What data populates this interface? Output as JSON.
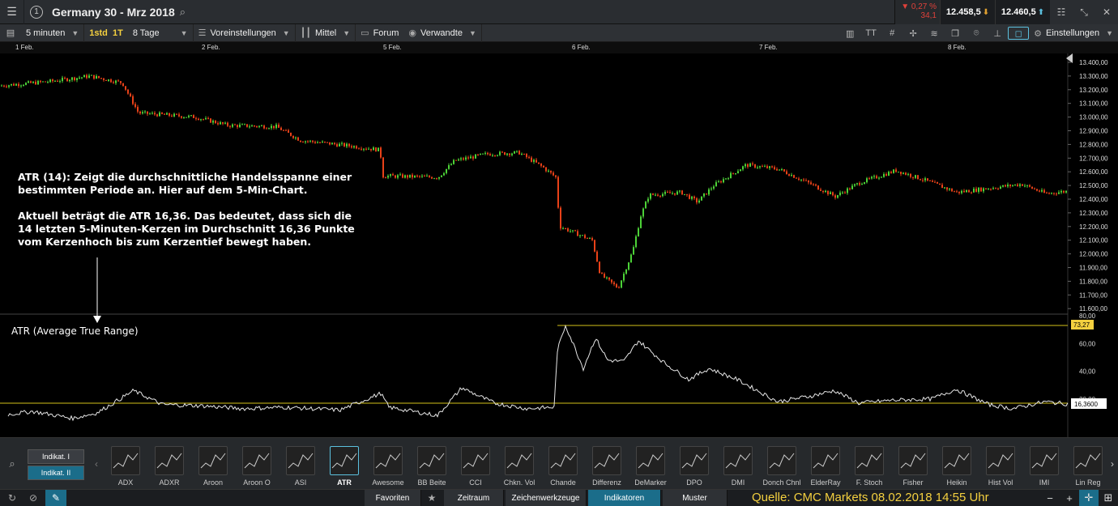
{
  "header": {
    "menu_icon": "hamburger-icon",
    "product_number": "1",
    "title": "Germany 30 - Mrz 2018",
    "change_pct": "▼ 0,27 %",
    "change_pts": "34,1",
    "bid": "12.458,5",
    "ask": "12.460,5",
    "bid_icon": "arrow-down-icon",
    "ask_icon": "arrow-up-icon"
  },
  "toolbar": {
    "interval": "5 minuten",
    "first_label": "1std",
    "second_label": "1T",
    "range": "8 Tage",
    "presets": "Voreinstellungen",
    "chart_type": "Mittel",
    "forum": "Forum",
    "related": "Verwandte",
    "settings": "Einstellungen",
    "text_icon_label": "TT"
  },
  "dates": [
    "1 Feb.",
    "2 Feb.",
    "5 Feb.",
    "6 Feb.",
    "7 Feb.",
    "8 Feb."
  ],
  "price_axis": [
    "13.400,00",
    "13.300,00",
    "13.200,00",
    "13.100,00",
    "13.000,00",
    "12.900,00",
    "12.800,00",
    "12.700,00",
    "12.600,00",
    "12.500,00",
    "12.400,00",
    "12.300,00",
    "12.200,00",
    "12.100,00",
    "12.000,00",
    "11.900,00",
    "11.800,00",
    "11.700,00",
    "11.600,00"
  ],
  "atr_axis": [
    "80,00",
    "60,00",
    "40,00",
    "20,00"
  ],
  "atr_max_label": "73,27",
  "atr_current_label": "16,3600",
  "annotation": {
    "p1": "ATR (14): Zeigt die durchschnittliche Handelsspanne einer bestimmten Periode an. Hier auf dem 5-Min-Chart.",
    "p2": "Aktuell beträgt die ATR 16,36. Das bedeutet, dass sich die 14 letzten 5-Minuten-Kerzen im Durchschnitt 16,36 Punkte vom Kerzenhoch bis zum Kerzentief bewegt haben."
  },
  "atr_title": "ATR (Average True Range)",
  "indicator_tabs": {
    "first": "Indikat. I",
    "second": "Indikat. II"
  },
  "indicators": [
    "ADX",
    "ADXR",
    "Aroon",
    "Aroon O",
    "ASI",
    "ATR",
    "Awesome",
    "BB Beite",
    "CCI",
    "Chkn. Vol",
    "Chande",
    "Differenz",
    "DeMarker",
    "DPO",
    "DMI",
    "Donch Chnl",
    "ElderRay",
    "F. Stoch",
    "Fisher",
    "Heikin",
    "Hist Vol",
    "IMI",
    "Lin Reg"
  ],
  "selected_indicator": "ATR",
  "status_tabs": [
    "Favoriten",
    "Zeitraum",
    "Zeichenwerkzeuge",
    "Indikatoren",
    "Muster"
  ],
  "active_tab": "Indikatoren",
  "source": "Quelle: CMC Markets 08.02.2018 14:55 Uhr",
  "colors": {
    "up": "#4cd137",
    "down": "#e84118",
    "atr_line": "#e6e6e6",
    "yellow": "#d4c21a",
    "accent": "#1b6d8a"
  },
  "chart_data": {
    "type": "line",
    "price_series": {
      "x": [
        "1 Feb.",
        "2 Feb.",
        "5 Feb.",
        "6 Feb.",
        "7 Feb.",
        "8 Feb."
      ],
      "y": [
        13250,
        13050,
        12750,
        11750,
        12600,
        12458
      ],
      "ylim": [
        11600,
        13400
      ]
    },
    "atr_series": {
      "values": [
        8,
        12,
        26,
        14,
        22,
        9,
        28,
        16,
        73.27,
        48,
        42,
        30,
        16,
        20,
        18,
        16.36
      ],
      "ylim": [
        0,
        80
      ],
      "max": 73.27,
      "current": 16.36
    }
  }
}
